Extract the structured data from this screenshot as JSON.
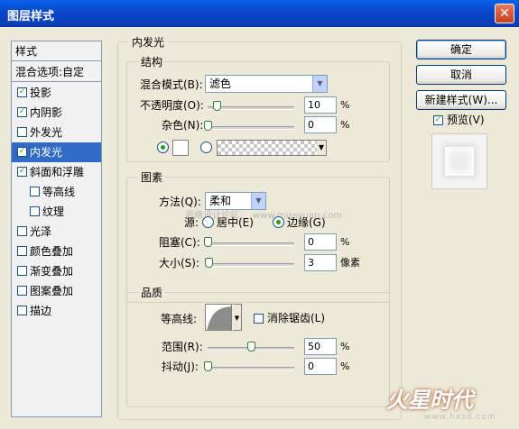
{
  "window": {
    "title": "图层样式",
    "close_glyph": "✕"
  },
  "styles_panel": {
    "header": "样式",
    "blend_options": "混合选项:自定",
    "items": [
      {
        "label": "投影",
        "checked": true
      },
      {
        "label": "内阴影",
        "checked": true
      },
      {
        "label": "外发光",
        "checked": false
      },
      {
        "label": "内发光",
        "checked": true,
        "selected": true
      },
      {
        "label": "斜面和浮雕",
        "checked": true
      },
      {
        "label": "等高线",
        "checked": false,
        "indent": true
      },
      {
        "label": "纹理",
        "checked": false,
        "indent": true
      },
      {
        "label": "光泽",
        "checked": false
      },
      {
        "label": "颜色叠加",
        "checked": false
      },
      {
        "label": "渐变叠加",
        "checked": false
      },
      {
        "label": "图案叠加",
        "checked": false
      },
      {
        "label": "描边",
        "checked": false
      }
    ]
  },
  "inner_glow": {
    "title": "内发光",
    "structure": {
      "title": "结构",
      "blend_mode_label": "混合模式(B):",
      "blend_mode_value": "滤色",
      "opacity_label": "不透明度(O):",
      "opacity_value": "10",
      "opacity_unit": "%",
      "opacity_level": 0.1,
      "noise_label": "杂色(N):",
      "noise_value": "0",
      "noise_unit": "%",
      "noise_level": 0.0,
      "color_radio_selected": true,
      "gradient_radio_selected": false
    },
    "elements": {
      "title": "图素",
      "technique_label": "方法(Q):",
      "technique_value": "柔和",
      "source_label": "源:",
      "source_center": "居中(E)",
      "source_edge": "边缘(G)",
      "source_selected": "edge",
      "choke_label": "阻塞(C):",
      "choke_value": "0",
      "choke_unit": "%",
      "choke_level": 0.0,
      "size_label": "大小(S):",
      "size_value": "3",
      "size_unit": "像素",
      "size_level": 0.012
    },
    "quality": {
      "title": "品质",
      "contour_label": "等高线:",
      "anti_aliased_label": "消除锯齿(L)",
      "anti_aliased_checked": false,
      "range_label": "范围(R):",
      "range_value": "50",
      "range_unit": "%",
      "range_level": 0.5,
      "jitter_label": "抖动(J):",
      "jitter_value": "0",
      "jitter_unit": "%",
      "jitter_level": 0.0
    }
  },
  "buttons": {
    "ok": "确定",
    "cancel": "取消",
    "new_style": "新建样式(W)...",
    "preview_label": "预览(V)",
    "preview_checked": true
  },
  "watermarks": {
    "forum": "思缘设计论坛",
    "url": "www.missyuan.com",
    "logo": "火星时代",
    "logo_url": "www.hxsd.com"
  },
  "icons": {
    "close": "close-icon",
    "dropdown": "chevron-down-icon",
    "check": "check-icon"
  },
  "colors": {
    "titlebar": "#0a61e8",
    "selection": "#316ac5",
    "checkmark": "#21a121"
  }
}
